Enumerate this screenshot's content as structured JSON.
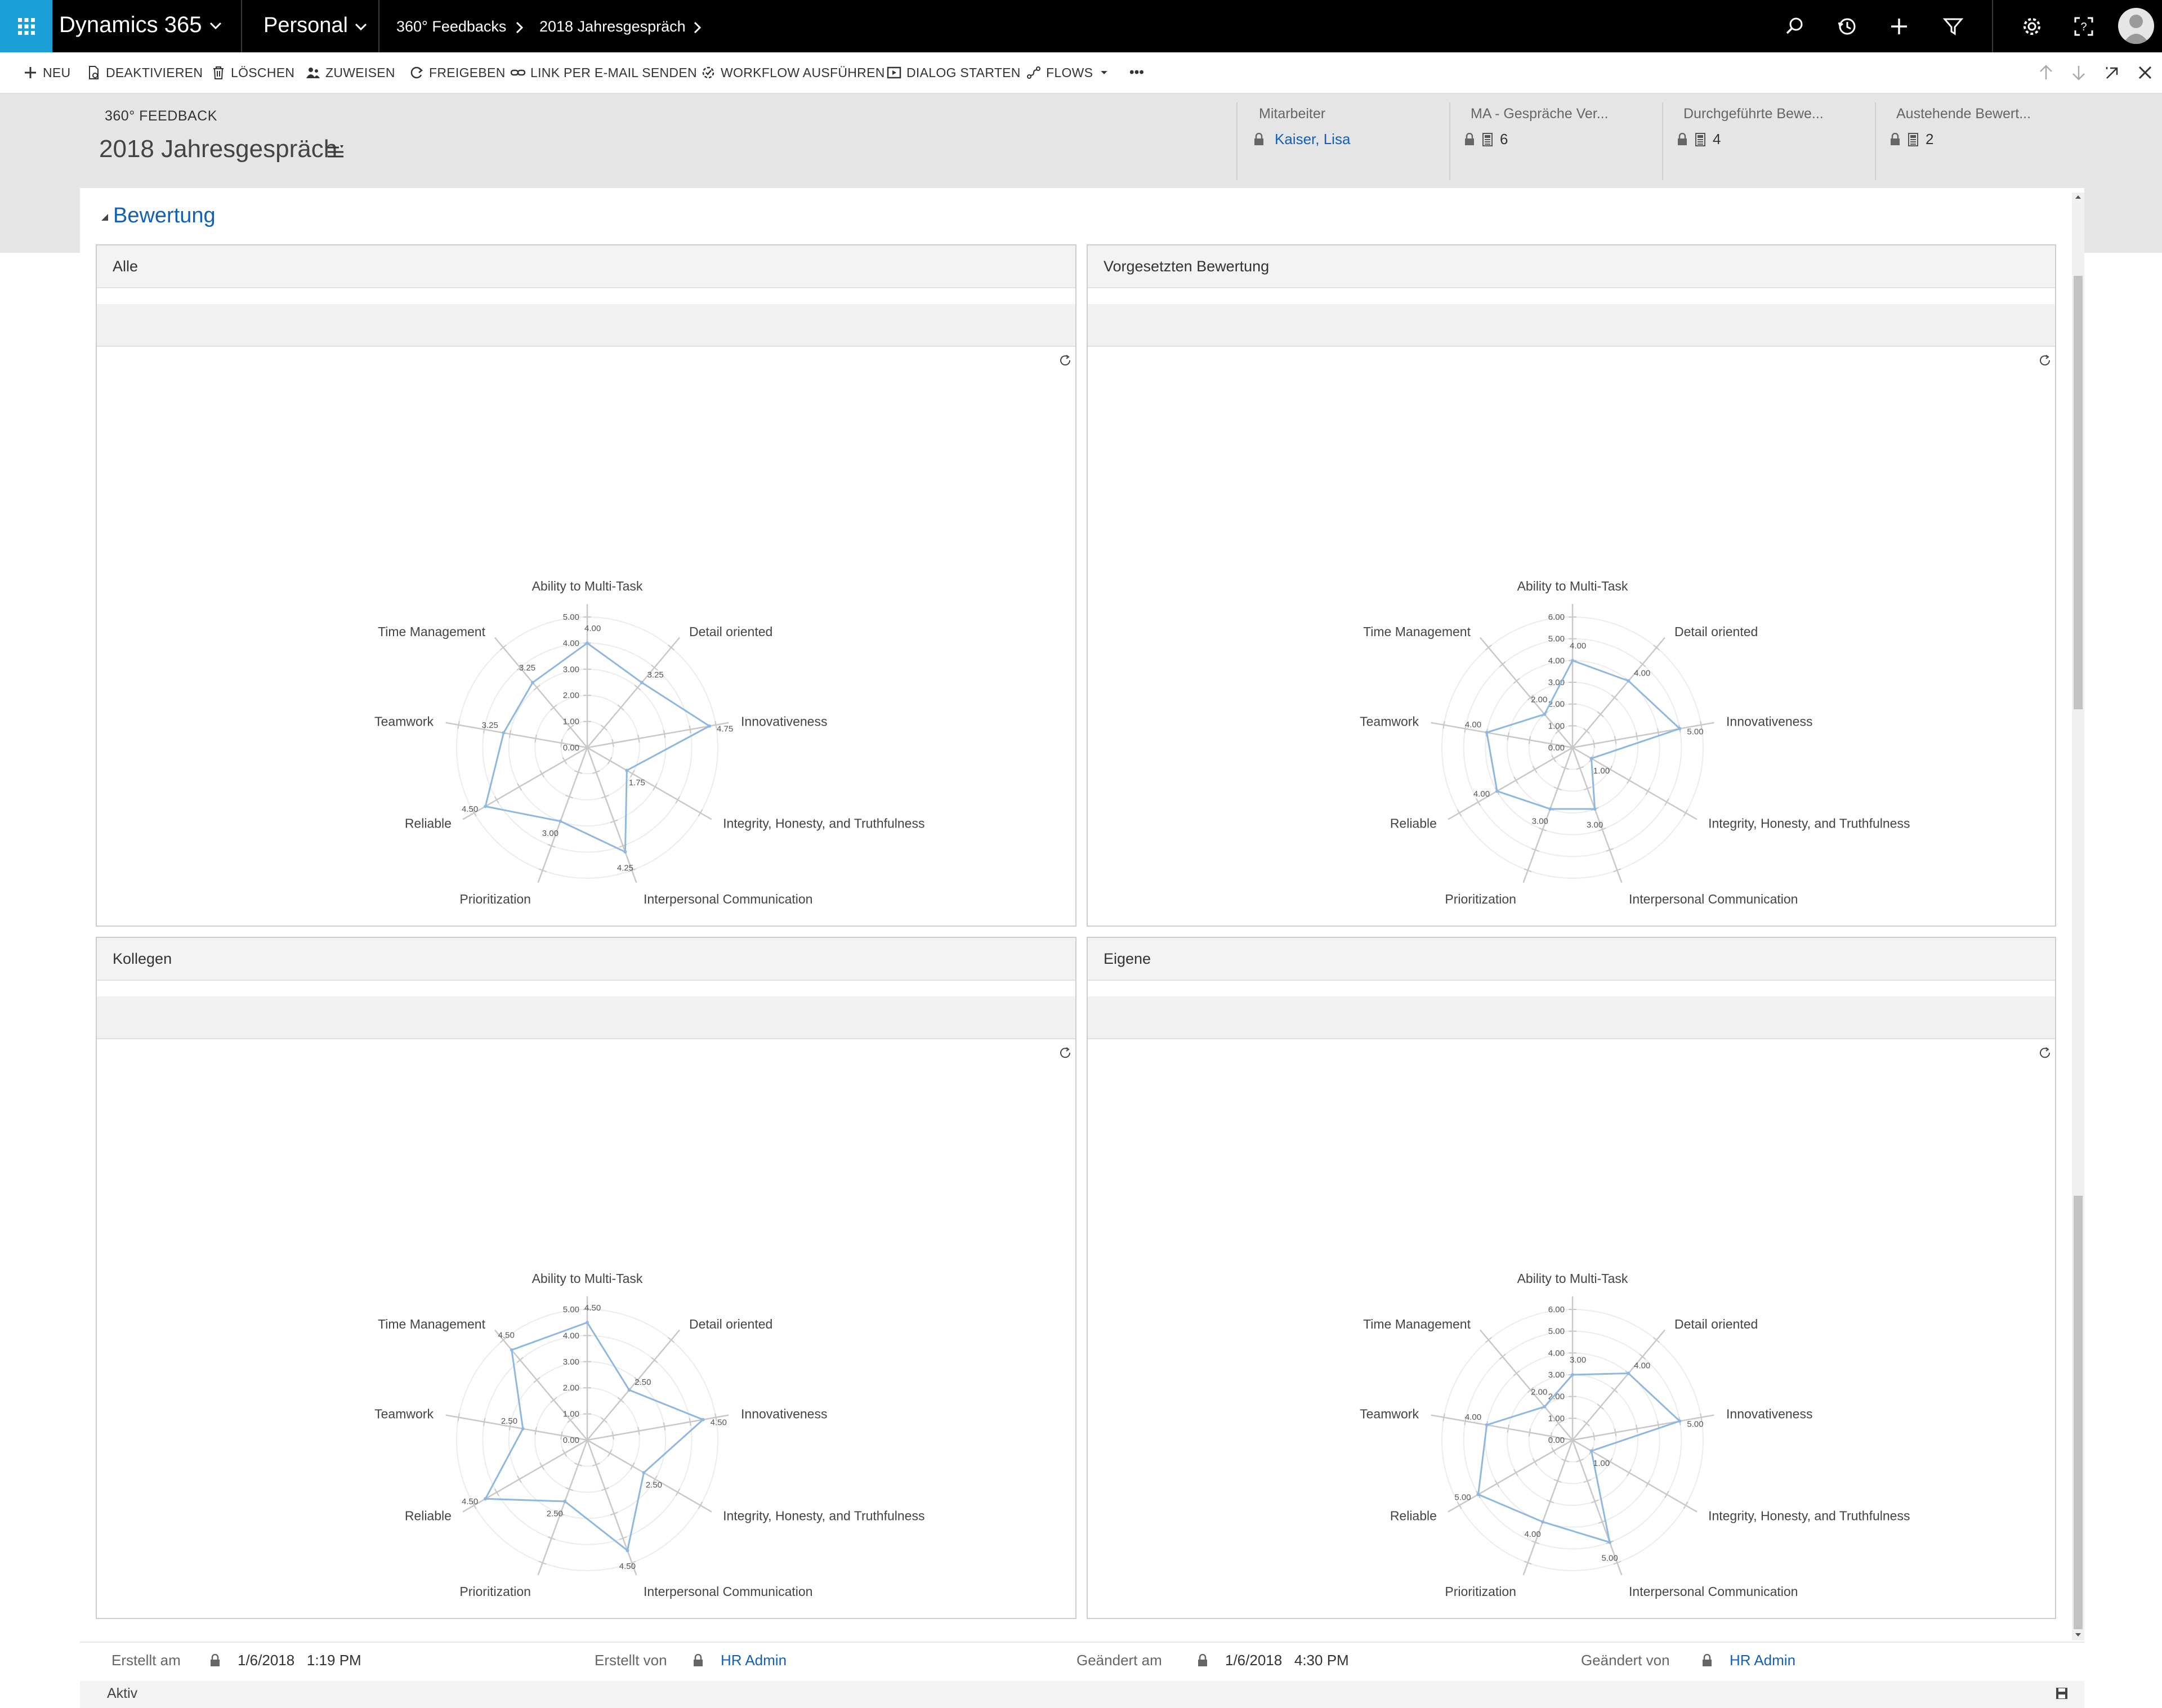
{
  "topbar": {
    "app_name": "Dynamics 365",
    "area": "Personal",
    "breadcrumb": [
      "360° Feedbacks",
      "2018 Jahresgespräch"
    ],
    "icons": [
      "search-icon",
      "history-icon",
      "plus-icon",
      "filter-icon",
      "settings-icon",
      "help-icon",
      "user-avatar"
    ]
  },
  "commands": {
    "new": "NEU",
    "deactivate": "DEAKTIVIEREN",
    "delete": "LÖSCHEN",
    "assign": "ZUWEISEN",
    "share": "FREIGEBEN",
    "email_link": "LINK PER E-MAIL SENDEN",
    "run_workflow": "WORKFLOW AUSFÜHREN",
    "start_dialog": "DIALOG STARTEN",
    "flows": "FLOWS",
    "more": "•••"
  },
  "header": {
    "entity": "360° FEEDBACK",
    "title": "2018 Jahresgespräch",
    "fields": [
      {
        "label": "Mitarbeiter",
        "value": "Kaiser, Lisa"
      },
      {
        "label": "MA - Gespräche Ver...",
        "value": "6"
      },
      {
        "label": "Durchgeführte Bewe...",
        "value": "4"
      },
      {
        "label": "Austehende Bewert...",
        "value": "2"
      }
    ]
  },
  "section": {
    "title": "Bewertung"
  },
  "panels": {
    "all": "Alle",
    "supervisor": "Vorgesetzten Bewertung",
    "colleagues": "Kollegen",
    "self": "Eigene"
  },
  "chart_data": [
    {
      "type": "radar",
      "panel": "Alle",
      "categories": [
        "Ability to Multi-Task",
        "Detail oriented",
        "Innovativeness",
        "Integrity, Honesty, and Truthfulness",
        "Interpersonal Communication",
        "Prioritization",
        "Reliable",
        "Teamwork",
        "Time Management"
      ],
      "values": [
        4.0,
        3.25,
        4.75,
        1.75,
        4.25,
        3.0,
        4.5,
        3.25,
        3.25
      ],
      "value_labels": [
        "4.00",
        "3.25",
        "4.75",
        "1.75",
        "4.25",
        "3.00",
        "4.50",
        "3.25",
        "3.25"
      ],
      "ticks": [
        "0.00",
        "1.00",
        "2.00",
        "3.00",
        "4.00",
        "5.00"
      ],
      "max": 5
    },
    {
      "type": "radar",
      "panel": "Vorgesetzten Bewertung",
      "categories": [
        "Ability to Multi-Task",
        "Detail oriented",
        "Innovativeness",
        "Integrity, Honesty, and Truthfulness",
        "Interpersonal Communication",
        "Prioritization",
        "Reliable",
        "Teamwork",
        "Time Management"
      ],
      "values": [
        4.0,
        4.0,
        5.0,
        1.0,
        3.0,
        3.0,
        4.0,
        4.0,
        2.0
      ],
      "value_labels": [
        "4.00",
        "4.00",
        "5.00",
        "1.00",
        "3.00",
        "3.00",
        "4.00",
        "4.00",
        "2.00"
      ],
      "ticks": [
        "0.00",
        "1.00",
        "2.00",
        "3.00",
        "4.00",
        "5.00",
        "6.00"
      ],
      "max": 6
    },
    {
      "type": "radar",
      "panel": "Kollegen",
      "categories": [
        "Ability to Multi-Task",
        "Detail oriented",
        "Innovativeness",
        "Integrity, Honesty, and Truthfulness",
        "Interpersonal Communication",
        "Prioritization",
        "Reliable",
        "Teamwork",
        "Time Management"
      ],
      "values": [
        4.5,
        2.5,
        4.5,
        2.5,
        4.5,
        2.5,
        4.5,
        2.5,
        4.5
      ],
      "value_labels": [
        "4.50",
        "2.50",
        "4.50",
        "2.50",
        "4.50",
        "2.50",
        "4.50",
        "2.50",
        "4.50"
      ],
      "ticks": [
        "0.00",
        "1.00",
        "2.00",
        "3.00",
        "4.00",
        "5.00"
      ],
      "max": 5
    },
    {
      "type": "radar",
      "panel": "Eigene",
      "categories": [
        "Ability to Multi-Task",
        "Detail oriented",
        "Innovativeness",
        "Integrity, Honesty, and Truthfulness",
        "Interpersonal Communication",
        "Prioritization",
        "Reliable",
        "Teamwork",
        "Time Management"
      ],
      "values": [
        3.0,
        4.0,
        5.0,
        1.0,
        5.0,
        4.0,
        5.0,
        4.0,
        2.0
      ],
      "value_labels": [
        "3.00",
        "4.00",
        "5.00",
        "1.00",
        "5.00",
        "4.00",
        "5.00",
        "4.00",
        "2.00"
      ],
      "ticks": [
        "0.00",
        "1.00",
        "2.00",
        "3.00",
        "4.00",
        "5.00",
        "6.00"
      ],
      "max": 6
    }
  ],
  "footer": {
    "created_on_label": "Erstellt am",
    "created_on": "1/6/2018   1:19 PM",
    "created_by_label": "Erstellt von",
    "created_by": "HR Admin",
    "modified_on_label": "Geändert am",
    "modified_on": "1/6/2018   4:30 PM",
    "modified_by_label": "Geändert von",
    "modified_by": "HR Admin"
  },
  "status": "Aktiv",
  "colors": {
    "accent": "#1a9fd6",
    "link": "#1160b7",
    "series": "#8fb8e0",
    "topbar": "#000000"
  }
}
